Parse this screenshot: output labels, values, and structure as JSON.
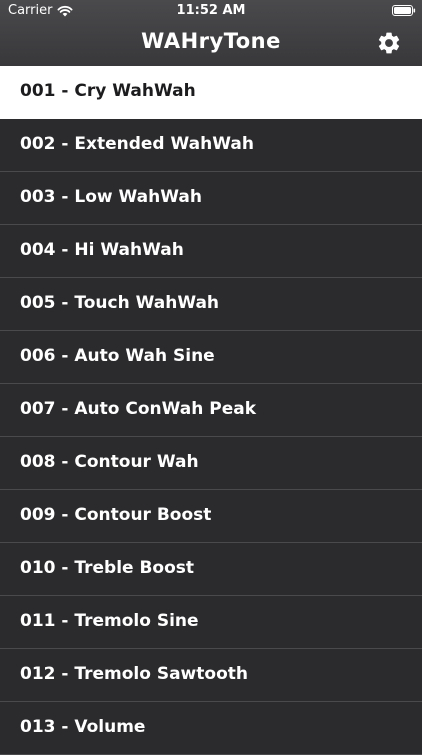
{
  "status_bar": {
    "carrier": "Carrier",
    "time": "11:52 AM",
    "wifi_icon": "wifi-icon",
    "battery_icon": "battery-icon"
  },
  "nav": {
    "title": "WAHryTone",
    "settings_icon": "gear-icon"
  },
  "colors": {
    "background": "#2b2b2e",
    "header": "#3c3c3f",
    "selected_row": "#ffffff",
    "text": "#ffffff",
    "selected_text": "#1c1c1e",
    "separator": "#4a4a4d"
  },
  "presets": [
    {
      "label": "001 - Cry WahWah",
      "selected": true
    },
    {
      "label": "002 - Extended WahWah",
      "selected": false
    },
    {
      "label": "003 - Low WahWah",
      "selected": false
    },
    {
      "label": "004 - Hi WahWah",
      "selected": false
    },
    {
      "label": "005 - Touch WahWah",
      "selected": false
    },
    {
      "label": "006 - Auto Wah Sine",
      "selected": false
    },
    {
      "label": "007 - Auto ConWah Peak",
      "selected": false
    },
    {
      "label": "008 - Contour Wah",
      "selected": false
    },
    {
      "label": "009 - Contour Boost",
      "selected": false
    },
    {
      "label": "010 - Treble Boost",
      "selected": false
    },
    {
      "label": "011 - Tremolo Sine",
      "selected": false
    },
    {
      "label": "012 - Tremolo Sawtooth",
      "selected": false
    },
    {
      "label": "013 - Volume",
      "selected": false
    }
  ]
}
